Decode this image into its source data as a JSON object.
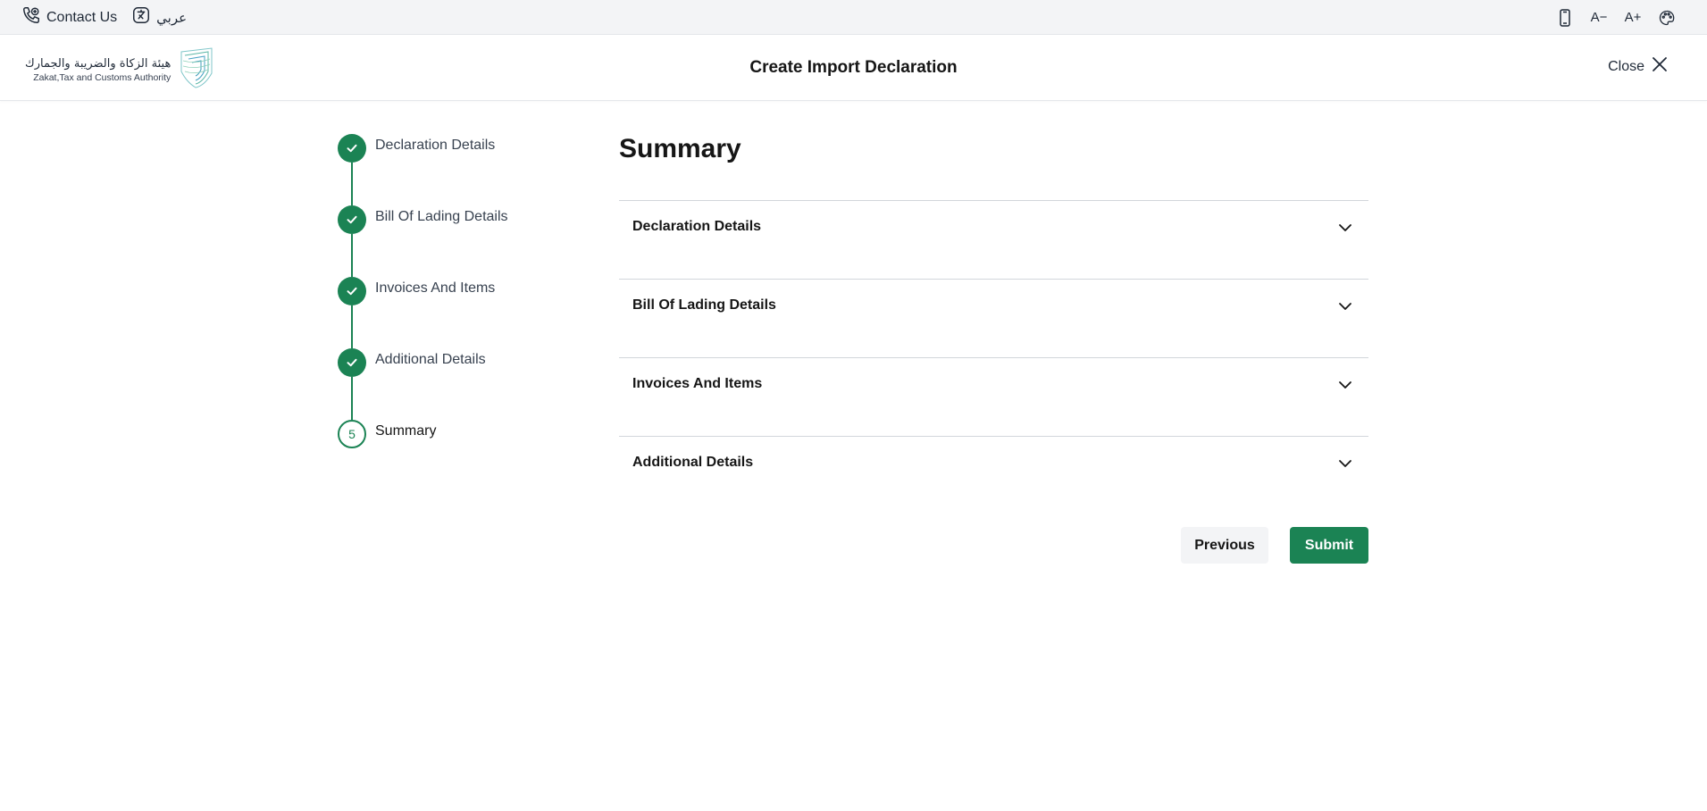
{
  "topbar": {
    "contact_label": "Contact Us",
    "language_label": "عربي",
    "tools": [
      {
        "icon": "mobile-icon"
      },
      {
        "icon": "font-decrease-icon",
        "label": "A−"
      },
      {
        "icon": "font-increase-icon",
        "label": "A+"
      },
      {
        "icon": "palette-icon"
      }
    ]
  },
  "header": {
    "logo_ar": "هيئة الزكاة والضريبة والجمارك",
    "logo_en": "Zakat,Tax and Customs Authority",
    "title": "Create Import Declaration",
    "close_label": "Close"
  },
  "stepper": {
    "steps": [
      {
        "label": "Declaration Details",
        "status": "completed"
      },
      {
        "label": "Bill Of Lading Details",
        "status": "completed"
      },
      {
        "label": "Invoices And Items",
        "status": "completed"
      },
      {
        "label": "Additional Details",
        "status": "completed"
      },
      {
        "label": "Summary",
        "status": "current",
        "number": "5"
      }
    ]
  },
  "main": {
    "heading": "Summary",
    "sections": [
      {
        "title": "Declaration Details"
      },
      {
        "title": "Bill Of Lading Details"
      },
      {
        "title": "Invoices And Items"
      },
      {
        "title": "Additional Details"
      }
    ]
  },
  "actions": {
    "previous_label": "Previous",
    "submit_label": "Submit"
  },
  "colors": {
    "primary": "#1b8354",
    "topbar_bg": "#f3f4f6"
  }
}
